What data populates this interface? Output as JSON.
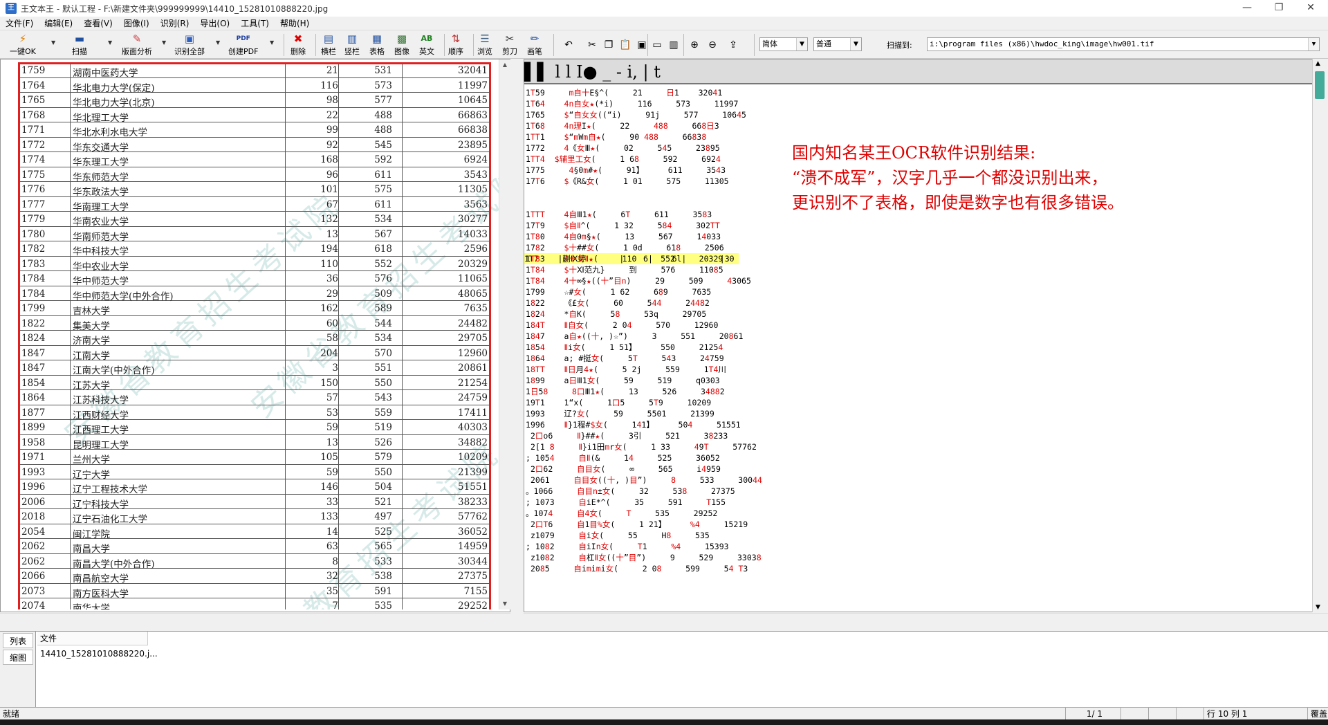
{
  "window": {
    "title": "王文本王 - 默认工程 - F:\\新建文件夹\\999999999\\14410_15281010888220.jpg",
    "minimize": "—",
    "restore": "❐",
    "close": "✕"
  },
  "menu": [
    "文件(F)",
    "编辑(E)",
    "查看(V)",
    "图像(I)",
    "识别(R)",
    "导出(O)",
    "工具(T)",
    "帮助(H)"
  ],
  "toolbar": {
    "buttons": [
      {
        "name": "one-click-ok",
        "label": "一键OK",
        "icon": "lightning-icon"
      },
      {
        "name": "scan",
        "label": "扫描",
        "icon": "scanner-icon"
      },
      {
        "name": "layout-analysis",
        "label": "版面分析",
        "icon": "layout-icon"
      },
      {
        "name": "recognize-all",
        "label": "识别全部",
        "icon": "recognize-icon"
      },
      {
        "name": "create-pdf",
        "label": "创建PDF",
        "icon": "pdf-icon"
      },
      {
        "name": "delete",
        "label": "删除",
        "icon": "delete-icon"
      },
      {
        "name": "horizontal",
        "label": "横栏",
        "icon": "horizontal-icon"
      },
      {
        "name": "vertical",
        "label": "竖栏",
        "icon": "vertical-icon"
      },
      {
        "name": "table",
        "label": "表格",
        "icon": "table-icon"
      },
      {
        "name": "image",
        "label": "图像",
        "icon": "image-icon"
      },
      {
        "name": "english",
        "label": "英文",
        "icon": "english-icon"
      },
      {
        "name": "order",
        "label": "顺序",
        "icon": "order-icon"
      },
      {
        "name": "browse",
        "label": "浏览",
        "icon": "browse-icon"
      },
      {
        "name": "cut",
        "label": "剪刀",
        "icon": "scissors-icon"
      },
      {
        "name": "brush",
        "label": "画笔",
        "icon": "pen-icon"
      }
    ],
    "pdf_icon_text": "PDF",
    "english_icon_text": "AB",
    "language": "简体",
    "mode": "普通",
    "scan_to_label": "扫描到:",
    "scan_to_path": "i:\\program files (x86)\\hwdoc_king\\image\\hw001.tif"
  },
  "image_table": {
    "rows": [
      [
        "1759",
        "湖南中医药大学",
        "21",
        "531",
        "32041"
      ],
      [
        "1764",
        "华北电力大学(保定)",
        "116",
        "573",
        "11997"
      ],
      [
        "1765",
        "华北电力大学(北京)",
        "98",
        "577",
        "10645"
      ],
      [
        "1768",
        "华北理工大学",
        "22",
        "488",
        "66863"
      ],
      [
        "1771",
        "华北水利水电大学",
        "99",
        "488",
        "66838"
      ],
      [
        "1772",
        "华东交通大学",
        "92",
        "545",
        "23895"
      ],
      [
        "1774",
        "华东理工大学",
        "168",
        "592",
        "6924"
      ],
      [
        "1775",
        "华东师范大学",
        "96",
        "611",
        "3543"
      ],
      [
        "1776",
        "华东政法大学",
        "101",
        "575",
        "11305"
      ],
      [
        "1777",
        "华南理工大学",
        "67",
        "611",
        "3563"
      ],
      [
        "1779",
        "华南农业大学",
        "132",
        "534",
        "30277"
      ],
      [
        "1780",
        "华南师范大学",
        "13",
        "567",
        "14033"
      ],
      [
        "1782",
        "华中科技大学",
        "194",
        "618",
        "2596"
      ],
      [
        "1783",
        "华中农业大学",
        "110",
        "552",
        "20329"
      ],
      [
        "1784",
        "华中师范大学",
        "36",
        "576",
        "11065"
      ],
      [
        "1784",
        "华中师范大学(中外合作)",
        "29",
        "509",
        "48065"
      ],
      [
        "1799",
        "吉林大学",
        "162",
        "589",
        "7635"
      ],
      [
        "1822",
        "集美大学",
        "60",
        "544",
        "24482"
      ],
      [
        "1824",
        "济南大学",
        "58",
        "534",
        "29705"
      ],
      [
        "1847",
        "江南大学",
        "204",
        "570",
        "12960"
      ],
      [
        "1847",
        "江南大学(中外合作)",
        "3",
        "551",
        "20861"
      ],
      [
        "1854",
        "江苏大学",
        "150",
        "550",
        "21254"
      ],
      [
        "1864",
        "江苏科技大学",
        "57",
        "543",
        "24759"
      ],
      [
        "1877",
        "江西财经大学",
        "53",
        "559",
        "17411"
      ],
      [
        "1899",
        "江西理工大学",
        "59",
        "519",
        "40303"
      ],
      [
        "1958",
        "昆明理工大学",
        "13",
        "526",
        "34882"
      ],
      [
        "1971",
        "兰州大学",
        "105",
        "579",
        "10209"
      ],
      [
        "1993",
        "辽宁大学",
        "59",
        "550",
        "21399"
      ],
      [
        "1996",
        "辽宁工程技术大学",
        "146",
        "504",
        "51551"
      ],
      [
        "2006",
        "辽宁科技大学",
        "33",
        "521",
        "38233"
      ],
      [
        "2018",
        "辽宁石油化工大学",
        "133",
        "497",
        "57762"
      ],
      [
        "2054",
        "闽江学院",
        "14",
        "525",
        "36052"
      ],
      [
        "2062",
        "南昌大学",
        "63",
        "565",
        "14959"
      ],
      [
        "2062",
        "南昌大学(中外合作)",
        "8",
        "533",
        "30344"
      ],
      [
        "2066",
        "南昌航空大学",
        "32",
        "538",
        "27375"
      ],
      [
        "2073",
        "南方医科大学",
        "35",
        "591",
        "7155"
      ],
      [
        "2074",
        "南华大学",
        "7",
        "535",
        "29252"
      ]
    ],
    "watermark": [
      "安徽省教育招生考试院",
      "安徽省教育招生考试院",
      "安徽省教育招生考试院"
    ]
  },
  "ocr_result": {
    "header": "▌▌ l l I● _ - i, | t",
    "lines": [
      "1T59     m自十E§^(     21     日1    32041",
      "1T64    4n自女★(*i)     116     573     11997",
      "1765    $“自女女((“i)     91j     577     10645",
      "1T68    4n理I★(     22     488     668日3",
      "1TT1    $“mWm自★(     90 488     66838",
      "1772    4《女Ⅲ★(     02     545     23895",
      "1TT4  $辅里工女(     1 68     592     6924",
      "1775     4§0m#★(     91】     611     3543",
      "17T6    $《R&女(     1 01     575     11305",
      "",
      "1TTT    4自Ⅲ1★(     6T     611     3583",
      "17T9    $自Ⅱ^(     1 32     584     302TT",
      "1T80    4自0m§★(     13     567     14033",
      "1782    $十##女(     1 0d     618     2506",
      "1T83    4十女Ⅱ★(     110     552     20329",
      "1T84    $十Ⅺ范九}     到     576     11085",
      "1T84    4十∞§★((十”目n)     29     509     43065",
      "1799    ☆#女(     1 62     689     7635",
      "1822    《£女(     60     544     24482",
      "1824    *自K(     58     53q     29705",
      "184T    Ⅱ自女(     2 04     570     12960",
      "1847    a自★((十, )☆”)     3     551     20861",
      "1854    Ⅱi女(     1 51】     550     21254",
      "1864    a; #挺女(     5T     543     24759",
      "18TT    Ⅱ日月4★(     5 2j     559     1T4川",
      "1899    a日Ⅲ1女(     59     519     q0303",
      "1日58     8口Ⅲ1★(     13     526     34882",
      "19T1    1“x(     1口5     5T9     10209",
      "1993    辽?女(     59     5501     21399",
      "1996    Ⅱ}1程#$女(     141】     504     51551",
      " 2口o6     Ⅱ}##★(     3引     521     38233",
      " 2[1 8     Ⅱ}i1田mr女(     1 33     49T     57762",
      "; 1054     自Ⅱ(&     14     525     36052",
      " 2口62     自目女(     ∞     565     i4959",
      " 2061     自目女((十, )目”)     8     533     30044",
      "。1066     自目n±女(     32     538     27375",
      "; 1073     自iE*^(     35     591     T155",
      "。1074     自4女(     T     535     29252",
      " 2口T6     自1目%女(     1 21】     %4     15219",
      " z1079     自i女(     55     H8     535",
      "; 1082     自iIn女(     T1     %4     15393",
      " z1082     自杠Ⅱ女((十”目”)     9     529     33038",
      " 2085     自imimi女(     2 08     599     54 T3"
    ],
    "highlight": "1T7    |蒯Ⅸ婷       |    6|    6l|       |30"
  },
  "annotation": [
    "国内知名某王OCR软件识别结果:",
    "“溃不成军”，汉字几乎一个都没识别出来，",
    "更识别不了表格，即使是数字也有很多错误。"
  ],
  "bottom": {
    "tabs": [
      "列表",
      "缩图"
    ],
    "column_header": "文件",
    "filename": "14410_15281010888220.j..."
  },
  "status": {
    "ready": "就绪",
    "page": "1/  1",
    "position": "行  10 列  1",
    "overwrite": "覆盖"
  },
  "colors": {
    "accent_red": "#e00000",
    "frame_red": "#e02020",
    "highlight": "#ffff80",
    "watermark": "#46a096"
  }
}
